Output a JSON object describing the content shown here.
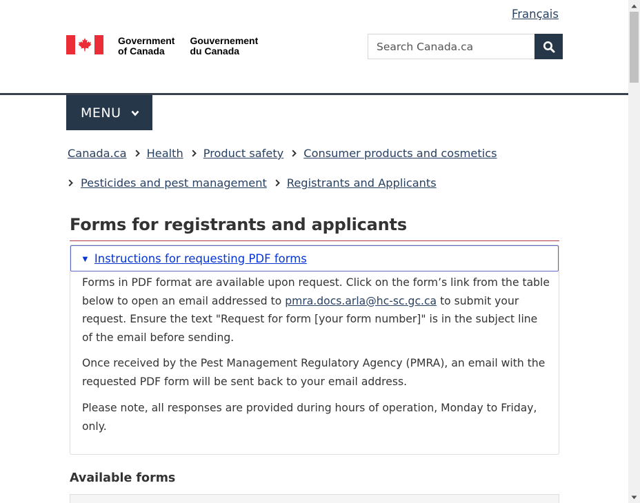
{
  "header": {
    "language_link": "Français",
    "signature": {
      "en_line1": "Government",
      "en_line2": "of Canada",
      "fr_line1": "Gouvernement",
      "fr_line2": "du Canada",
      "flag_color": "#eb2d37"
    },
    "search": {
      "placeholder": "Search Canada.ca",
      "button_icon": "search-icon"
    }
  },
  "menu": {
    "label": "MENU",
    "icon": "chevron-down-icon"
  },
  "breadcrumb": {
    "row1": [
      "Canada.ca",
      "Health",
      "Product safety",
      "Consumer products and cosmetics"
    ],
    "row2": [
      "Pesticides and pest management",
      "Registrants and Applicants"
    ]
  },
  "main": {
    "title": "Forms for registrants and applicants",
    "details": {
      "summary": "Instructions for requesting PDF forms",
      "p1_before": "Forms in PDF format are available upon request. Click on the form’s link from the table below to open an email addressed to ",
      "p1_email": "pmra.docs.arla@hc-sc.gc.ca",
      "p1_after": " to submit your request. Ensure the text \"Request for form [your form number]\" is in the subject line of the email before sending.",
      "p2": "Once received by the Pest Management Regulatory Agency (PMRA), an email with the requested PDF form will be sent back to your email address.",
      "p3": "Please note, all responses are provided during hours of operation, Monday to Friday, only."
    },
    "available_heading": "Available forms"
  },
  "colors": {
    "nav_dark": "#26374a",
    "link": "#284162",
    "summary_link": "#0535d2",
    "title_rule": "#af3c43"
  }
}
